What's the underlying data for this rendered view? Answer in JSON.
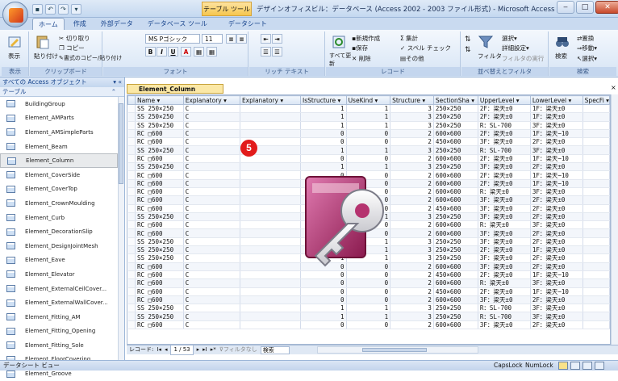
{
  "window": {
    "title": "デザインオフィスビル：データベース (Access 2002 - 2003 ファイル形式) - Microsoft Access",
    "context_tab": "テーブル ツール",
    "controls": [
      "‒",
      "□",
      "✕"
    ]
  },
  "ribbon_tabs": [
    "ホーム",
    "作成",
    "外部データ",
    "データベース ツール",
    "データシート"
  ],
  "ribbon": {
    "view": {
      "label": "表示",
      "group": "表示"
    },
    "clipboard": {
      "paste": "貼り付け",
      "cut": "切り取り",
      "copy": "コピー",
      "format_painter": "書式のコピー/貼り付け",
      "group": "クリップボード"
    },
    "font": {
      "name": "MS Pゴシック",
      "size": "11",
      "group": "フォント"
    },
    "rich_text": {
      "group": "リッチ テキスト"
    },
    "records": {
      "refresh": "すべて更新",
      "new": "新規作成",
      "save": "保存",
      "delete": "削除",
      "sum": "集計",
      "spell": "スペル チェック",
      "more": "その他",
      "group": "レコード"
    },
    "sort_filter": {
      "filter": "フィルタ",
      "select": "選択",
      "advanced": "詳細設定",
      "toggle": "フィルタの実行",
      "group": "並べ替えとフィルタ"
    },
    "find": {
      "find": "検索",
      "replace": "置換",
      "goto": "移動",
      "select": "選択",
      "group": "検索"
    }
  },
  "nav_pane": {
    "header": "すべての Access オブジェクト",
    "section": "テーブル",
    "items": [
      "BuildingGroup",
      "Element_AMParts",
      "Element_AMSimpleParts",
      "Element_Beam",
      "Element_Column",
      "Element_CoverSide",
      "Element_CoverTop",
      "Element_CrownMoulding",
      "Element_Curb",
      "Element_DecorationSlip",
      "Element_DesignJointMesh",
      "Element_Eave",
      "Element_Elevator",
      "Element_ExternalCeilCover...",
      "Element_ExternalWallCover...",
      "Element_Fitting_AM",
      "Element_Fitting_Opening",
      "Element_Fitting_Sole",
      "Element_FloorCovering",
      "Element_Groove"
    ],
    "selected_index": 4
  },
  "document_tab": "Element_Column",
  "grid": {
    "columns": [
      "Name",
      "Explanatory",
      "Explanatory",
      "IsStructure",
      "UseKind",
      "Structure",
      "SectionSha",
      "UpperLevel",
      "LowerLevel",
      "SpecFi"
    ],
    "rows": [
      [
        "SS 250×250",
        "C",
        "",
        "1",
        "1",
        "3",
        "250×250",
        "2F：梁天±0",
        "1F：梁天±0",
        ""
      ],
      [
        "SS 250×250",
        "C",
        "",
        "1",
        "1",
        "3",
        "250×250",
        "2F：梁天±0",
        "1F：梁天±0",
        ""
      ],
      [
        "SS 250×250",
        "C",
        "",
        "1",
        "1",
        "3",
        "250×250",
        "R：SL-700",
        "3F：梁天±0",
        ""
      ],
      [
        "RC □600",
        "C",
        "",
        "0",
        "0",
        "2",
        "600×600",
        "2F：梁天±0",
        "1F：梁天−10",
        ""
      ],
      [
        "RC □600",
        "C",
        "",
        "0",
        "0",
        "2",
        "450×600",
        "3F：梁天±0",
        "2F：梁天±0",
        ""
      ],
      [
        "SS 250×250",
        "C",
        "",
        "1",
        "1",
        "3",
        "250×250",
        "R：SL-700",
        "3F：梁天±0",
        ""
      ],
      [
        "RC □600",
        "C",
        "",
        "0",
        "0",
        "2",
        "600×600",
        "2F：梁天±0",
        "1F：梁天−10",
        ""
      ],
      [
        "SS 250×250",
        "C",
        "",
        "1",
        "1",
        "3",
        "250×250",
        "3F：梁天±0",
        "2F：梁天±0",
        ""
      ],
      [
        "RC □600",
        "C",
        "",
        "0",
        "0",
        "2",
        "600×600",
        "2F：梁天±0",
        "1F：梁天−10",
        ""
      ],
      [
        "RC □600",
        "C",
        "",
        "0",
        "0",
        "2",
        "600×600",
        "2F：梁天±0",
        "1F：梁天−10",
        ""
      ],
      [
        "RC □600",
        "C",
        "",
        "0",
        "0",
        "2",
        "600×600",
        "R：梁天±0",
        "3F：梁天±0",
        ""
      ],
      [
        "RC □600",
        "C",
        "",
        "0",
        "0",
        "2",
        "600×600",
        "3F：梁天±0",
        "2F：梁天±0",
        ""
      ],
      [
        "RC □600",
        "C",
        "",
        "0",
        "0",
        "2",
        "450×600",
        "3F：梁天±0",
        "2F：梁天±0",
        ""
      ],
      [
        "SS 250×250",
        "C",
        "",
        "1",
        "1",
        "3",
        "250×250",
        "3F：梁天±0",
        "2F：梁天±0",
        ""
      ],
      [
        "RC □600",
        "C",
        "",
        "0",
        "0",
        "2",
        "600×600",
        "R：梁天±0",
        "3F：梁天±0",
        ""
      ],
      [
        "RC □600",
        "C",
        "",
        "0",
        "0",
        "2",
        "600×600",
        "3F：梁天±0",
        "2F：梁天±0",
        ""
      ],
      [
        "SS 250×250",
        "C",
        "",
        "1",
        "1",
        "3",
        "250×250",
        "3F：梁天±0",
        "2F：梁天±0",
        ""
      ],
      [
        "SS 250×250",
        "C",
        "",
        "1",
        "1",
        "3",
        "250×250",
        "2F：梁天±0",
        "1F：梁天±0",
        ""
      ],
      [
        "SS 250×250",
        "C",
        "",
        "1",
        "1",
        "3",
        "250×250",
        "3F：梁天±0",
        "2F：梁天±0",
        ""
      ],
      [
        "RC □600",
        "C",
        "",
        "0",
        "0",
        "2",
        "600×600",
        "3F：梁天±0",
        "2F：梁天±0",
        ""
      ],
      [
        "RC □600",
        "C",
        "",
        "0",
        "0",
        "2",
        "450×600",
        "2F：梁天±0",
        "1F：梁天−10",
        ""
      ],
      [
        "RC □600",
        "C",
        "",
        "0",
        "0",
        "2",
        "600×600",
        "R：梁天±0",
        "3F：梁天±0",
        ""
      ],
      [
        "RC □600",
        "C",
        "",
        "0",
        "0",
        "2",
        "450×600",
        "2F：梁天±0",
        "1F：梁天−10",
        ""
      ],
      [
        "RC □600",
        "C",
        "",
        "0",
        "0",
        "2",
        "600×600",
        "3F：梁天±0",
        "2F：梁天±0",
        ""
      ],
      [
        "SS 250×250",
        "C",
        "",
        "1",
        "1",
        "3",
        "250×250",
        "R：SL-700",
        "3F：梁天±0",
        ""
      ],
      [
        "SS 250×250",
        "C",
        "",
        "1",
        "1",
        "3",
        "250×250",
        "R：SL-700",
        "3F：梁天±0",
        ""
      ],
      [
        "RC □600",
        "C",
        "",
        "0",
        "0",
        "2",
        "600×600",
        "3F：梁天±0",
        "2F：梁天±0",
        ""
      ]
    ]
  },
  "record_nav": {
    "label": "レコード:",
    "position": "1 / 53",
    "filter": "フィルタなし",
    "search": "検索"
  },
  "status": {
    "left": "データシート ビュー",
    "capslock": "CapsLock",
    "numlock": "NumLock"
  },
  "step_badge": "5",
  "colors": {
    "accent": "#15428b",
    "badge": "#e21b1b",
    "doc_tab": "#fbe8a6"
  }
}
